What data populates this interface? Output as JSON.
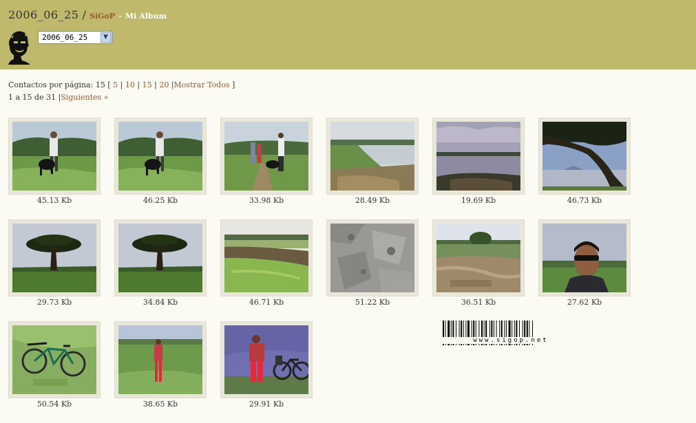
{
  "header": {
    "album_date": "2006_06_25",
    "separator": "/",
    "brand": "SiGoP",
    "dash": "-",
    "album_name": "Mi Album",
    "select_value": "2006_06_25"
  },
  "pager": {
    "label": "Contactos por página:",
    "current": "15",
    "open_bracket": "[",
    "close_bracket": "]",
    "sep": "|",
    "options": [
      "5",
      "10",
      "15",
      "20",
      "Mostrar Todos"
    ],
    "range_text": "1 a 15 de 31",
    "next_label": "Siguientes »"
  },
  "photos": [
    {
      "size": "45.13 Kb",
      "scene": "man-dog"
    },
    {
      "size": "46.25 Kb",
      "scene": "man-dog"
    },
    {
      "size": "33.98 Kb",
      "scene": "group"
    },
    {
      "size": "28.49 Kb",
      "scene": "lake-shore"
    },
    {
      "size": "19.69 Kb",
      "scene": "lake-dusk"
    },
    {
      "size": "46.73 Kb",
      "scene": "tree-branch"
    },
    {
      "size": "29.73 Kb",
      "scene": "acacia"
    },
    {
      "size": "34.84 Kb",
      "scene": "acacia"
    },
    {
      "size": "46.71 Kb",
      "scene": "ravine"
    },
    {
      "size": "51.22 Kb",
      "scene": "rock"
    },
    {
      "size": "36.51 Kb",
      "scene": "dry-field"
    },
    {
      "size": "27.62 Kb",
      "scene": "selfie"
    },
    {
      "size": "50.54 Kb",
      "scene": "bicycle"
    },
    {
      "size": "38.65 Kb",
      "scene": "person-red"
    },
    {
      "size": "29.91 Kb",
      "scene": "person-bike"
    }
  ],
  "barcode_text": "www.sigop.net"
}
